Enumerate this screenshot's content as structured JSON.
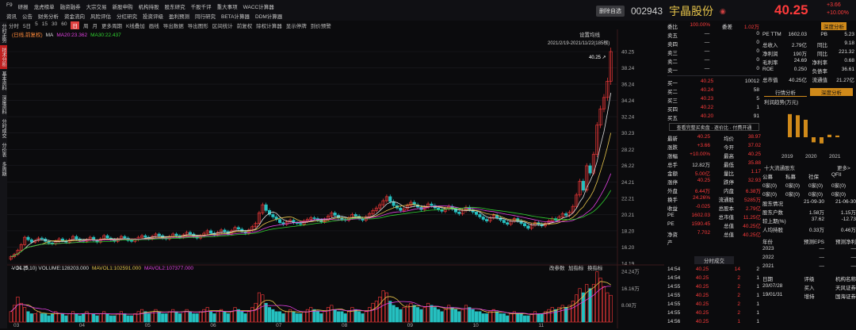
{
  "menu_row1": [
    "F9",
    "研报",
    "龙虎榜单",
    "融资融券",
    "大宗交易",
    "新股申购",
    "机构持股",
    "股东研究",
    "千股千评",
    "重大事项",
    "WACC计算器"
  ],
  "menu_row2": [
    "资讯",
    "公告",
    "财务分析",
    "资金流向",
    "风险评估",
    "分红研究",
    "投资评级",
    "盈利预测",
    "同行研究",
    "BETA计算器",
    "DDM计算器"
  ],
  "header": {
    "delete_label": "删除自选",
    "code": "002943",
    "name": "宇晶股份",
    "price": "40.25",
    "change": "+3.66",
    "change_pct": "+10.00%"
  },
  "left_tabs": [
    "分时走势",
    "技术分析",
    "基本资料",
    "深度资料",
    "分时成交",
    "分价表",
    "多周期"
  ],
  "toolbar": [
    "分时",
    "5日",
    "5",
    "15",
    "30",
    "60",
    "日",
    "周",
    "月",
    "更多周期",
    "K线叠加",
    "画线",
    "导出数据",
    "导出图形",
    "区间统计",
    "前复权",
    "除权计算器",
    "显示停牌",
    "到价预警"
  ],
  "chart_legend": {
    "adj": "(日线,前复权)",
    "ma": "MA",
    "ma20": "MA20:23.362",
    "ma30": "MA30:22.437"
  },
  "chart_info": {
    "settings": "设置均线",
    "range": "2021/2/19-2021/11/22(185根)",
    "top_label": "40.25"
  },
  "price_axis": [
    "40.25",
    "38.24",
    "36.24",
    "34.24",
    "32.24",
    "30.23",
    "28.22",
    "26.22",
    "24.21",
    "22.21",
    "20.21",
    "18.20",
    "16.20",
    "14.19"
  ],
  "low_label": "14.25",
  "volume_legend": {
    "vol": "VOL (5,10) VOLUME:128203.000",
    "m1": "MAVOL1:102591.000",
    "m2": "MAVOL2:107377.000",
    "tools": [
      "改参数",
      "加指标",
      "换指标"
    ]
  },
  "vol_axis": [
    "24.24万",
    "16.16万",
    "8.08万"
  ],
  "x_axis": [
    "03",
    "04",
    "05",
    "06",
    "07",
    "08",
    "09",
    "10",
    "11"
  ],
  "quote": {
    "top": [
      [
        "委比",
        "100.00%"
      ],
      [
        "委差",
        "1.02万"
      ]
    ],
    "asks": [
      [
        "卖五",
        "—",
        "0"
      ],
      [
        "卖四",
        "—",
        "0"
      ],
      [
        "卖三",
        "—",
        "0"
      ],
      [
        "卖二",
        "—",
        "0"
      ],
      [
        "卖一",
        "—",
        "0"
      ]
    ],
    "bids": [
      [
        "买一",
        "40.25",
        "10012"
      ],
      [
        "买二",
        "40.24",
        "58"
      ],
      [
        "买三",
        "40.23",
        "5"
      ],
      [
        "买四",
        "40.22",
        "1"
      ],
      [
        "买五",
        "40.20",
        "91"
      ]
    ],
    "note": "查看完整买卖盘 · 逐价比 · 付费开通",
    "stats": [
      [
        "最新",
        "40.25",
        "均价",
        "38.97"
      ],
      [
        "涨跌",
        "+3.66",
        "今开",
        "37.02"
      ],
      [
        "涨幅",
        "+10.00%",
        "最高",
        "40.25"
      ],
      [
        "总手",
        "12.82万",
        "最低",
        "35.88"
      ],
      [
        "金额",
        "5.00亿",
        "量比",
        "1.17"
      ],
      [
        "涨停",
        "40.25",
        "跌停",
        "32.93"
      ],
      [
        "外盘",
        "6.44万",
        "内盘",
        "6.38万"
      ],
      [
        "换手",
        "24.26%",
        "流通股",
        "5285万"
      ],
      [
        "收益",
        "-0.025",
        "总股本",
        "2.79亿"
      ],
      [
        "PE",
        "1602.03",
        "总市值",
        "11.25亿"
      ],
      [
        "PE",
        "1590.45",
        "总值",
        "40.25亿"
      ],
      [
        "净资产",
        "7.702",
        "总值",
        "40.25亿"
      ]
    ],
    "ticks_title": "分时成交",
    "ticks": [
      [
        "14:54",
        "40.25",
        "14",
        "2"
      ],
      [
        "14:54",
        "40.25",
        "2",
        "1"
      ],
      [
        "14:55",
        "40.25",
        "2",
        "1"
      ],
      [
        "14:55",
        "40.25",
        "2",
        "1"
      ],
      [
        "14:55",
        "40.25",
        "2",
        "1"
      ],
      [
        "14:55",
        "40.25",
        "2",
        "1"
      ],
      [
        "14:56",
        "40.25",
        "1",
        "1"
      ]
    ]
  },
  "fundamentals": {
    "pe_tabs": [
      "PE",
      "1602.03"
    ],
    "btn": "深度分析",
    "rows": [
      [
        "PE TTM",
        "1602.03",
        "PB",
        "5.23"
      ],
      [
        "总收入",
        "2.79亿",
        "同比",
        "9.18"
      ],
      [
        "净利润",
        "190万",
        "同比",
        "221.32"
      ],
      [
        "毛利率",
        "24.69",
        "净利率",
        "0.68"
      ],
      [
        "ROE",
        "0.250",
        "负债率",
        "36.61"
      ],
      [
        "总市值",
        "40.25亿",
        "流通值",
        "21.27亿"
      ]
    ],
    "tabs": [
      "行情分析",
      "深度分析"
    ],
    "profit_title": "利润趋势(万元)",
    "profit_years": [
      "2019",
      "2020",
      "2021"
    ],
    "profit_bars": [
      820,
      780,
      620,
      -180,
      -220,
      90,
      60
    ],
    "holders_title": "十大流通股东",
    "holders_more": "更多>",
    "holder_tabs": [
      "公募",
      "私募",
      "社保",
      "QFII"
    ],
    "holder_cols": [
      "0家(0)",
      "0家(0)",
      "0家(0)",
      "0家(0)"
    ],
    "holder_cols2": [
      "0家(0)",
      "0家(0)",
      "0家(0)",
      "0家(0)"
    ],
    "table_title": [
      "股东情况",
      "21-09-30",
      "21-06-30"
    ],
    "table": [
      [
        "股东户数",
        "1.58万",
        "1.15万"
      ],
      [
        "较上期(%)",
        "37.62",
        "-12.73"
      ],
      [
        "人均持股",
        "0.33万",
        "0.46万"
      ]
    ],
    "forecast_title": [
      "年份",
      "预测EPS",
      "预测净利"
    ],
    "forecast": [
      [
        "2023",
        "—",
        "—"
      ],
      [
        "2022",
        "—",
        "—"
      ],
      [
        "2021",
        "—",
        "—"
      ]
    ],
    "rating_title": [
      "日期",
      "评级",
      "机构名称"
    ],
    "rating": [
      [
        "20/07/28",
        "买入",
        "天风证券"
      ],
      [
        "19/01/31",
        "增持",
        "国海证券"
      ]
    ]
  },
  "chart_data": {
    "type": "candlestick",
    "ylim": [
      14.19,
      40.25
    ],
    "closes": [
      15.0,
      15.3,
      15.8,
      16.5,
      17.4,
      17.1,
      16.8,
      17.0,
      17.3,
      17.2,
      16.9,
      16.7,
      16.6,
      16.9,
      17.2,
      17.0,
      16.8,
      17.1,
      17.5,
      17.2,
      17.0,
      16.9,
      17.1,
      17.4,
      17.0,
      16.8,
      17.2,
      17.6,
      17.3,
      17.1,
      16.9,
      17.2,
      17.5,
      17.3,
      17.0,
      16.9,
      17.1,
      17.4,
      17.6,
      17.4,
      17.2,
      17.5,
      17.8,
      17.6,
      17.3,
      17.2,
      17.5,
      17.8,
      17.6,
      17.4,
      17.7,
      18.0,
      17.8,
      17.5,
      17.3,
      17.6,
      17.9,
      18.2,
      17.9,
      17.7,
      18.0,
      18.3,
      18.1,
      17.8,
      18.2,
      18.6,
      18.4,
      18.1,
      17.9,
      18.3,
      18.7,
      19.1,
      20.4,
      21.4,
      20.7,
      20.2,
      19.9,
      19.6,
      19.2,
      19.0,
      19.3,
      19.5,
      19.2,
      19.1,
      19.0,
      19.4,
      19.6,
      19.8,
      19.7,
      19.5,
      19.3,
      19.6,
      20.0,
      20.4,
      20.1,
      19.8,
      19.6,
      19.5,
      19.8,
      20.2,
      20.0,
      19.7,
      19.5,
      19.9,
      20.3,
      20.7,
      21.0,
      21.4,
      21.9,
      22.4,
      21.8,
      21.3,
      21.0,
      20.7,
      20.9,
      21.3,
      21.7,
      21.4,
      21.1,
      20.8,
      21.1,
      21.5,
      21.3,
      21.0,
      20.8,
      20.6,
      20.9,
      21.2,
      20.9,
      20.5,
      20.3,
      20.7,
      21.1,
      20.8,
      20.5,
      20.2,
      19.9,
      19.6,
      19.4,
      19.8,
      20.1,
      19.8,
      19.5,
      19.2,
      19.0,
      19.4,
      19.7,
      19.4,
      19.1,
      18.8,
      18.5,
      18.9,
      19.2,
      19.0,
      18.8,
      19.1,
      19.4,
      19.7,
      19.5,
      19.9,
      20.3,
      20.1,
      20.5,
      21.2,
      22.6,
      24.3,
      23.2,
      26.2,
      25.3,
      27.6,
      31.2,
      33.2,
      34.6,
      36.6,
      40.25
    ],
    "vol_max": 24.24,
    "vols": [
      5,
      8,
      12,
      9,
      7,
      5,
      4,
      4,
      5,
      4,
      4,
      3,
      4,
      5,
      4,
      4,
      3,
      4,
      5,
      4,
      3,
      4,
      5,
      4,
      4,
      3,
      4,
      5,
      4,
      3,
      3,
      4,
      5,
      4,
      3,
      3,
      4,
      5,
      6,
      5,
      4,
      5,
      6,
      5,
      4,
      4,
      5,
      6,
      5,
      4,
      5,
      6,
      5,
      4,
      4,
      5,
      6,
      7,
      5,
      4,
      5,
      6,
      5,
      4,
      5,
      7,
      6,
      5,
      4,
      5,
      7,
      9,
      14,
      13,
      9,
      7,
      6,
      5,
      5,
      4,
      5,
      6,
      5,
      4,
      4,
      5,
      6,
      7,
      6,
      5,
      4,
      5,
      7,
      8,
      6,
      5,
      5,
      4,
      5,
      7,
      6,
      5,
      4,
      5,
      7,
      9,
      10,
      12,
      15,
      14,
      10,
      8,
      7,
      6,
      7,
      8,
      9,
      8,
      7,
      6,
      7,
      9,
      8,
      7,
      6,
      5,
      6,
      8,
      7,
      6,
      5,
      6,
      8,
      7,
      6,
      5,
      5,
      4,
      4,
      5,
      6,
      5,
      4,
      4,
      3,
      4,
      5,
      4,
      4,
      3,
      3,
      4,
      5,
      4,
      4,
      5,
      6,
      7,
      6,
      7,
      8,
      7,
      8,
      10,
      13,
      16,
      14,
      18,
      16,
      18,
      24,
      21,
      17,
      14,
      12.8
    ]
  }
}
